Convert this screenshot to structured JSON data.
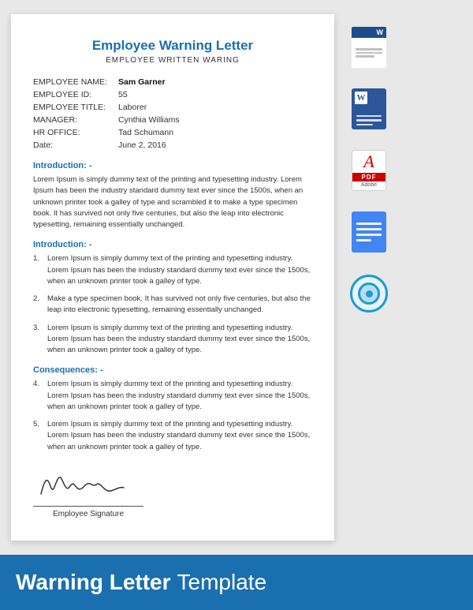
{
  "document": {
    "title": "Employee Warning Letter",
    "subtitle": "EMPLOYEE WRITTEN WARING",
    "fields": [
      {
        "label": "EMPLOYEE NAME:",
        "value": "Sam Garner",
        "bold": true
      },
      {
        "label": "EMPLOYEE ID:",
        "value": "55",
        "bold": false
      },
      {
        "label": "EMPLOYEE TITLE:",
        "value": "Laborer",
        "bold": false
      },
      {
        "label": "MANAGER:",
        "value": "Cynthia Williams",
        "bold": false
      },
      {
        "label": "HR OFFICE:",
        "value": "Tad Schumann",
        "bold": false
      },
      {
        "label": "Date:",
        "value": "June 2, 2016",
        "bold": false
      }
    ],
    "intro1_heading": "Introduction: -",
    "intro1_text": "Lorem Ipsum is simply dummy text of the printing and typesetting industry. Lorem Ipsum has been the industry standard dummy text ever since the 1500s, when an unknown printer took a galley of type and scrambled it to make a type specimen book. It has survived not only five centuries, but also the leap into electronic typesetting, remaining essentially unchanged.",
    "intro2_heading": "Introduction: -",
    "intro2_items": [
      {
        "num": "1.",
        "text": "Lorem Ipsum is simply dummy text of the printing and typesetting industry. Lorem Ipsum has been the industry standard dummy text ever since the 1500s, when an unknown printer took a galley of type."
      },
      {
        "num": "2.",
        "text": "Make a type specimen book. It has survived not only five centuries, but also the leap into electronic typesetting, remaining essentially unchanged."
      },
      {
        "num": "3.",
        "text": "Lorem Ipsum is simply dummy text of the printing and typesetting industry. Lorem Ipsum has been the industry standard dummy text ever since the 1500s, when an unknown printer took a galley of type."
      }
    ],
    "consequences_heading": "Consequences: -",
    "consequences_items": [
      {
        "num": "4.",
        "text": "Lorem Ipsum is simply dummy text of the printing and typesetting industry. Lorem Ipsum has been the industry standard dummy text ever since the 1500s, when an unknown printer took a galley of type."
      },
      {
        "num": "5.",
        "text": "Lorem Ipsum is simply dummy text of the printing and typesetting industry. Lorem Ipsum has been the industry standard dummy text ever since the 1500s, when an unknown printer took a galley of type."
      }
    ],
    "signature_label": "Employee Signature"
  },
  "sidebar": {
    "icons": [
      {
        "id": "word1",
        "type": "word",
        "label": "W"
      },
      {
        "id": "word2",
        "type": "word-lines",
        "label": "W"
      },
      {
        "id": "pdf",
        "type": "pdf",
        "label": "PDF"
      },
      {
        "id": "docs",
        "type": "docs",
        "label": "Docs"
      },
      {
        "id": "libre",
        "type": "libre",
        "label": "Libre"
      }
    ]
  },
  "banner": {
    "bold_text": "Warning Letter",
    "normal_text": "Template"
  }
}
